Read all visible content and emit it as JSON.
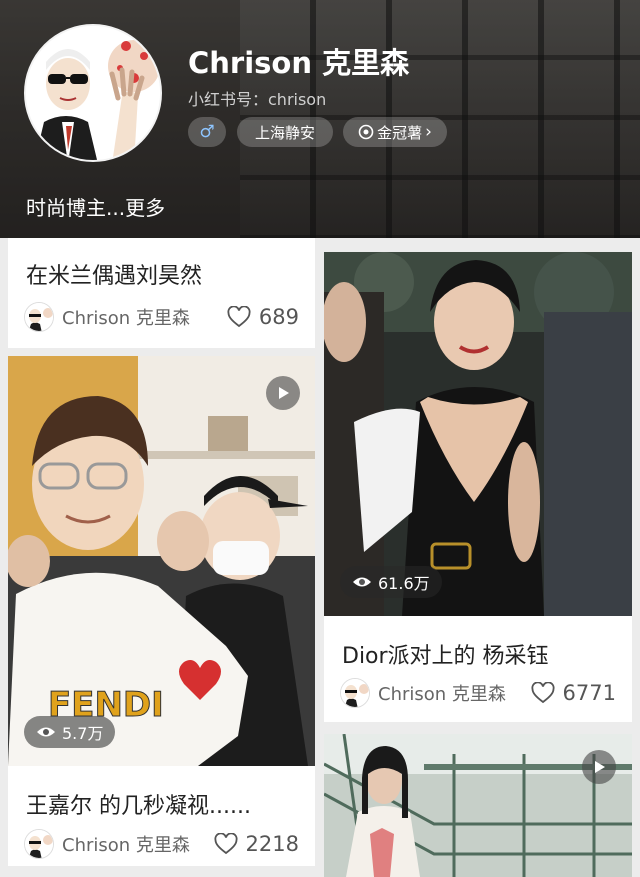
{
  "profile": {
    "name": "Chrison 克里森",
    "id_text": "小红书号：chrison",
    "gender_symbol": "♂",
    "location": "上海静安",
    "level": "金冠薯",
    "level_chevron": "›",
    "bio": "时尚博主...更多"
  },
  "colors": {
    "header_bg": "#3d3a37",
    "card_bg": "#ffffff",
    "feed_bg": "#ececec",
    "text_dark": "#222222",
    "text_muted": "#666666"
  },
  "feed": {
    "left": [
      {
        "title": "在米兰偶遇刘昊然",
        "author": "Chrison 克里森",
        "likes": "689"
      },
      {
        "title": "王嘉尔 的几秒凝视......",
        "author": "Chrison 克里森",
        "likes": "2218",
        "views": "5.7万",
        "is_video": true
      }
    ],
    "right": [
      {
        "title": "Dior派对上的 杨采钰",
        "author": "Chrison 克里森",
        "likes": "6771",
        "views": "61.6万"
      },
      {
        "is_video": true
      }
    ]
  }
}
